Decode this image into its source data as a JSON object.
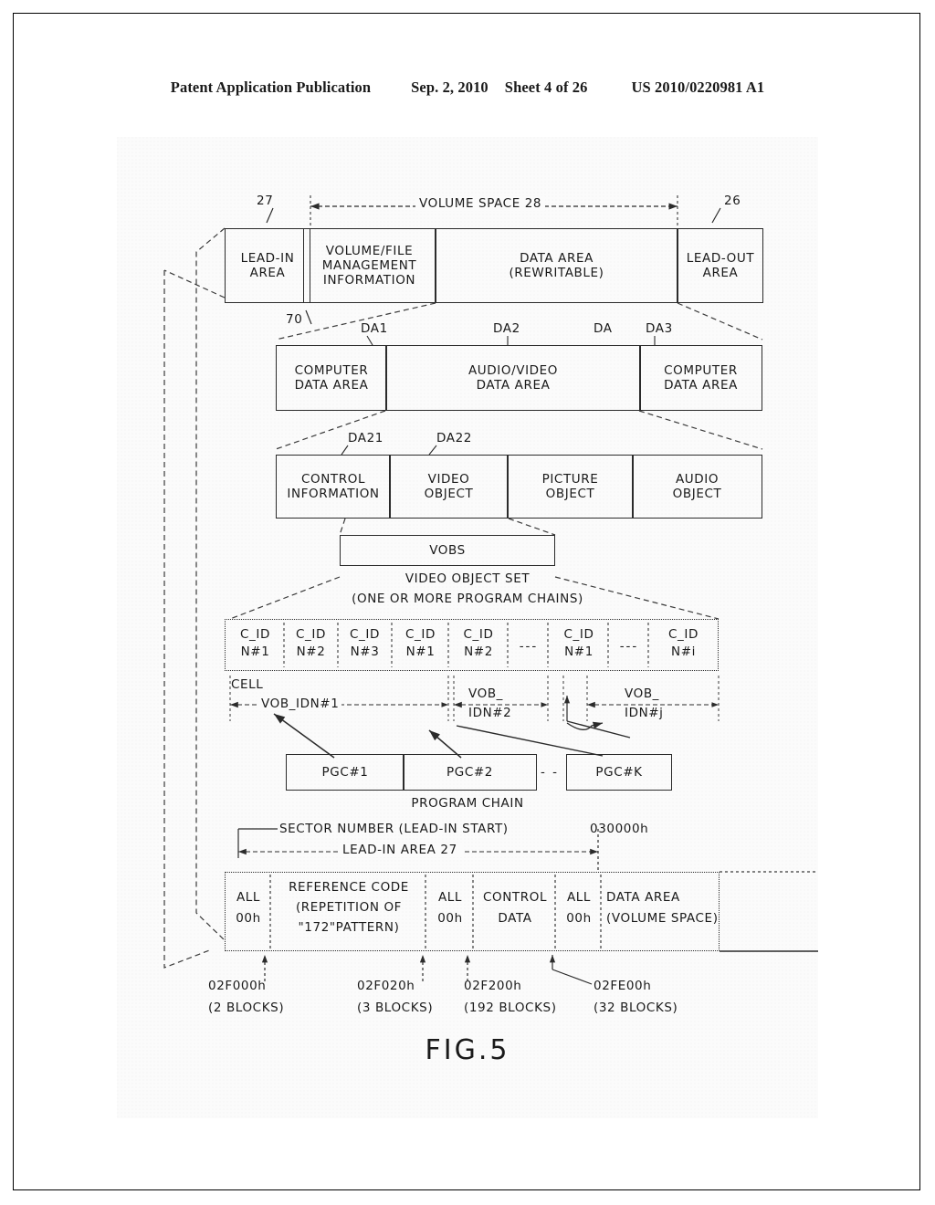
{
  "header": {
    "title": "Patent Application Publication",
    "date": "Sep. 2, 2010",
    "sheet": "Sheet 4 of 26",
    "patent_number": "US 2010/0220981 A1"
  },
  "figure": {
    "caption": "FIG.5"
  },
  "volume_row": {
    "span_label": "VOLUME SPACE 28",
    "ref_left": "27",
    "ref_right": "26",
    "ref_below": "70",
    "cells": [
      {
        "lines": [
          "LEAD-IN",
          "AREA"
        ]
      },
      {
        "lines": [
          "VOLUME/FILE",
          "MANAGEMENT",
          "INFORMATION"
        ]
      },
      {
        "lines": [
          "DATA AREA",
          "(REWRITABLE)"
        ]
      },
      {
        "lines": [
          "LEAD-OUT",
          "AREA"
        ]
      }
    ]
  },
  "data_area_row": {
    "tags": [
      "DA1",
      "DA2",
      "DA",
      "DA3"
    ],
    "cells": [
      {
        "lines": [
          "COMPUTER",
          "DATA AREA"
        ]
      },
      {
        "lines": [
          "AUDIO/VIDEO",
          "DATA AREA"
        ]
      },
      {
        "lines": [
          "COMPUTER",
          "DATA AREA"
        ]
      }
    ]
  },
  "av_row": {
    "tags": [
      "DA21",
      "DA22"
    ],
    "cells": [
      {
        "lines": [
          "CONTROL",
          "INFORMATION"
        ]
      },
      {
        "lines": [
          "VIDEO",
          "OBJECT"
        ]
      },
      {
        "lines": [
          "PICTURE",
          "OBJECT"
        ]
      },
      {
        "lines": [
          "AUDIO",
          "OBJECT"
        ]
      }
    ]
  },
  "vobs": {
    "box_label": "VOBS",
    "caption_line1": "VIDEO OBJECT SET",
    "caption_line2": "(ONE OR MORE PROGRAM CHAINS)"
  },
  "cell_row": {
    "cells": [
      {
        "top": "C_ID",
        "bottom": "N#1"
      },
      {
        "top": "C_ID",
        "bottom": "N#2"
      },
      {
        "top": "C_ID",
        "bottom": "N#3"
      },
      {
        "top": "C_ID",
        "bottom": "N#1"
      },
      {
        "top": "C_ID",
        "bottom": "N#2"
      },
      {
        "top": "",
        "bottom": "---"
      },
      {
        "top": "C_ID",
        "bottom": "N#1"
      },
      {
        "top": "",
        "bottom": "---"
      },
      {
        "top": "C_ID",
        "bottom": "N#i"
      }
    ],
    "cell_caption": "CELL",
    "spans": [
      {
        "line1": "VOB_IDN#1",
        "line2": ""
      },
      {
        "line1": "VOB_",
        "line2": "IDN#2"
      },
      {
        "line1": "VOB_",
        "line2": "IDN#j"
      }
    ]
  },
  "pgc_row": {
    "cells": [
      "PGC#1",
      "PGC#2",
      "PGC#K"
    ],
    "ellipsis": "- -",
    "caption": "PROGRAM CHAIN"
  },
  "sector_section": {
    "sector_label": "SECTOR NUMBER (LEAD-IN START)",
    "sector_value": "030000h",
    "leadin_span": "LEAD-IN AREA 27",
    "cells": [
      {
        "lines": [
          "ALL",
          "00h"
        ]
      },
      {
        "lines": [
          "REFERENCE CODE",
          "(REPETITION OF",
          "\"172\"PATTERN)"
        ]
      },
      {
        "lines": [
          "ALL",
          "00h"
        ]
      },
      {
        "lines": [
          "CONTROL",
          "DATA"
        ]
      },
      {
        "lines": [
          "ALL",
          "00h"
        ]
      },
      {
        "lines": [
          "DATA AREA",
          "(VOLUME SPACE)"
        ]
      }
    ],
    "markers": [
      {
        "address": "02F000h",
        "blocks": "(2 BLOCKS)"
      },
      {
        "address": "02F020h",
        "blocks": "(3 BLOCKS)"
      },
      {
        "address": "02F200h",
        "blocks": "(192 BLOCKS)"
      },
      {
        "address": "02FE00h",
        "blocks": "(32 BLOCKS)"
      }
    ]
  }
}
